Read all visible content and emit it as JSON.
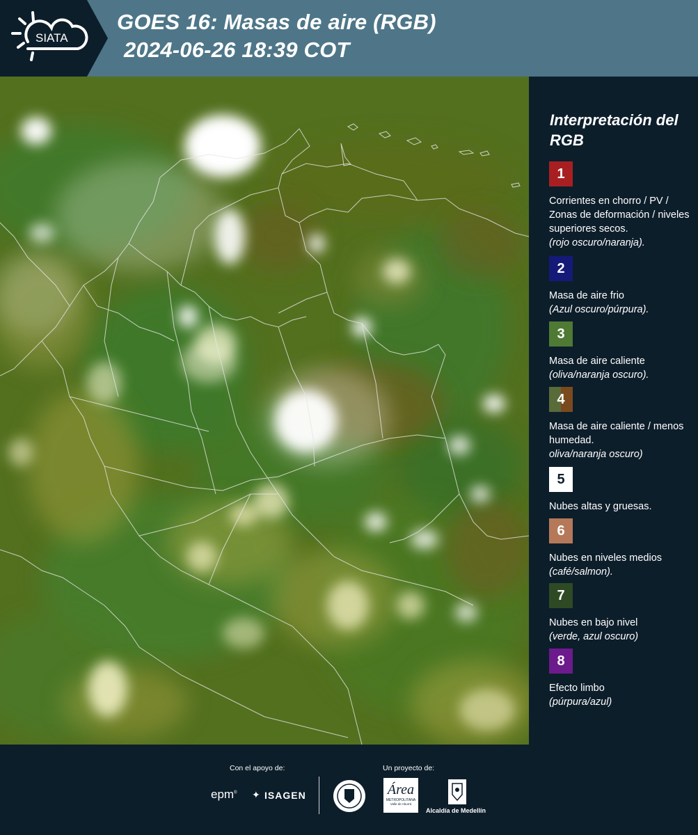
{
  "header": {
    "logo_text": "SIATA",
    "title_line1": "GOES 16: Masas de aire (RGB)",
    "title_line2": "2024-06-26 18:39 COT"
  },
  "legend": {
    "title": "Interpretación del RGB",
    "items": [
      {
        "number": "1",
        "color": "#a81f22",
        "desc": "Corrientes en chorro / PV / Zonas de deformación / niveles superiores secos.",
        "note": "(rojo oscuro/naranja)."
      },
      {
        "number": "2",
        "color": "#151a78",
        "desc": "Masa de aire frio",
        "note": "(Azul oscuro/púrpura)."
      },
      {
        "number": "3",
        "color": "#4e7a33",
        "desc": "Masa de aire caliente",
        "note": "(oliva/naranja oscuro)."
      },
      {
        "number": "4",
        "color": "#6b5b2c",
        "desc": "Masa de aire caliente / menos humedad.",
        "note": "oliva/naranja oscuro)"
      },
      {
        "number": "5",
        "color": "#ffffff",
        "desc": "Nubes altas y gruesas.",
        "note": ""
      },
      {
        "number": "6",
        "color": "#b5795a",
        "desc": "Nubes en niveles medios",
        "note": "(café/salmon)."
      },
      {
        "number": "7",
        "color": "#2d4a24",
        "desc": "Nubes en bajo nivel",
        "note": "(verde, azul oscuro)"
      },
      {
        "number": "8",
        "color": "#6c1a8c",
        "desc": "Efecto limbo",
        "note": "(púrpura/azul)"
      }
    ]
  },
  "footer": {
    "support_label": "Con el apoyo de:",
    "project_label": "Un proyecto de:",
    "epm": "epm",
    "isagen": "ISAGEN",
    "area_text": "Área",
    "metropolitana": "METROPOLITANA",
    "valle": "Valle de Aburrá",
    "alcaldia": "Alcaldía de Medellín"
  }
}
